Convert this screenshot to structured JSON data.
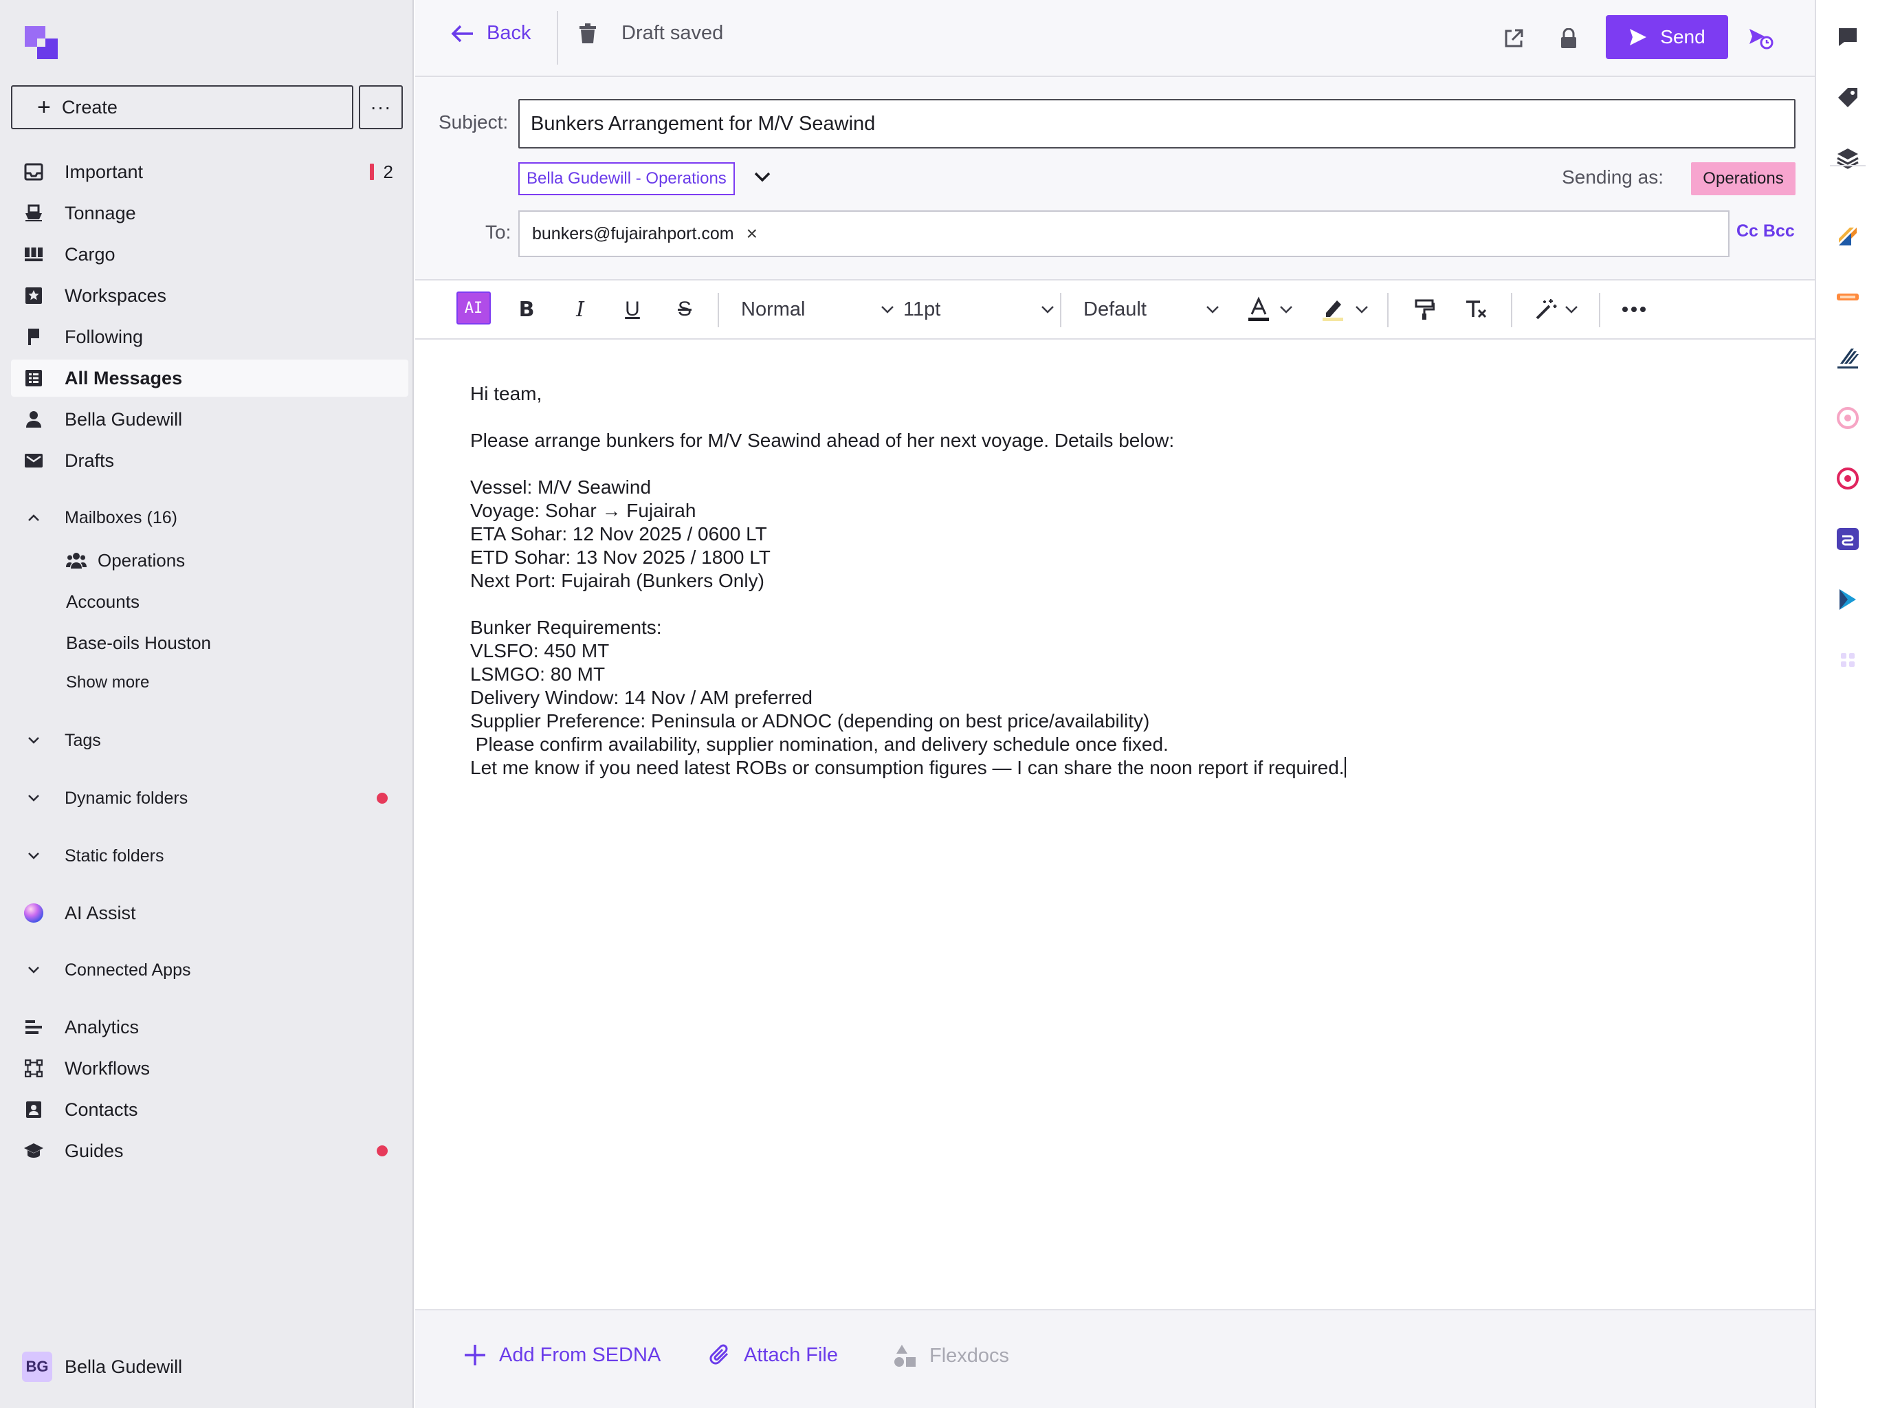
{
  "sidebar": {
    "create_label": "Create",
    "more_label": "···",
    "nav": [
      {
        "label": "Important",
        "icon": "inbox-icon",
        "count": "2"
      },
      {
        "label": "Tonnage",
        "icon": "ship-icon"
      },
      {
        "label": "Cargo",
        "icon": "cargo-icon"
      },
      {
        "label": "Workspaces",
        "icon": "star-icon"
      },
      {
        "label": "Following",
        "icon": "flag-icon"
      },
      {
        "label": "All Messages",
        "icon": "all-messages-icon",
        "active": true
      },
      {
        "label": "Bella Gudewill",
        "icon": "person-icon"
      },
      {
        "label": "Drafts",
        "icon": "mail-icon"
      }
    ],
    "mailboxes": {
      "label": "Mailboxes (16)",
      "items": [
        "Operations",
        "Accounts",
        "Base-oils Houston"
      ],
      "show_more": "Show more"
    },
    "tags": "Tags",
    "dynamic_folders": "Dynamic folders",
    "static_folders": "Static folders",
    "ai_assist": "AI Assist",
    "connected_apps": "Connected Apps",
    "bottom_nav": [
      "Analytics",
      "Workflows",
      "Contacts",
      "Guides"
    ],
    "user": {
      "initials": "BG",
      "name": "Bella Gudewill"
    }
  },
  "topbar": {
    "back_label": "Back",
    "draft_status": "Draft saved",
    "send_label": "Send"
  },
  "compose": {
    "subject_label": "Subject:",
    "subject_value": "Bunkers Arrangement for M/V Seawind",
    "from_value": "Bella Gudewill - Operations",
    "sending_as_label": "Sending as:",
    "sending_as_value": "Operations",
    "to_label": "To:",
    "to_recipient": "bunkers@fujairahport.com",
    "cc_bcc": "Cc Bcc"
  },
  "toolbar": {
    "ai_label": "AI",
    "paragraph_style": "Normal",
    "font_size": "11pt",
    "font_family": "Default"
  },
  "body": [
    "Hi team,",
    "",
    "Please arrange bunkers for M/V Seawind ahead of her next voyage. Details below:",
    "",
    "Vessel: M/V Seawind",
    "Voyage: Sohar → Fujairah",
    "ETA Sohar: 12 Nov 2025 / 0600 LT",
    "ETD Sohar: 13 Nov 2025 / 1800 LT",
    "Next Port: Fujairah (Bunkers Only)",
    "",
    "Bunker Requirements:",
    "VLSFO: 450 MT",
    "LSMGO: 80 MT",
    "Delivery Window: 14 Nov / AM preferred",
    "Supplier Preference: Peninsula or ADNOC (depending on best price/availability)",
    " Please confirm availability, supplier nomination, and delivery schedule once fixed.",
    "Let me know if you need latest ROBs or consumption figures — I can share the noon report if required."
  ],
  "bottombar": {
    "add_from": "Add From SEDNA",
    "attach": "Attach File",
    "flexdocs": "Flexdocs"
  },
  "colors": {
    "accent": "#7d3cf2",
    "accent_text": "#6a3bea",
    "alert": "#e63a5a",
    "tag_pink": "#f7a5cf"
  }
}
